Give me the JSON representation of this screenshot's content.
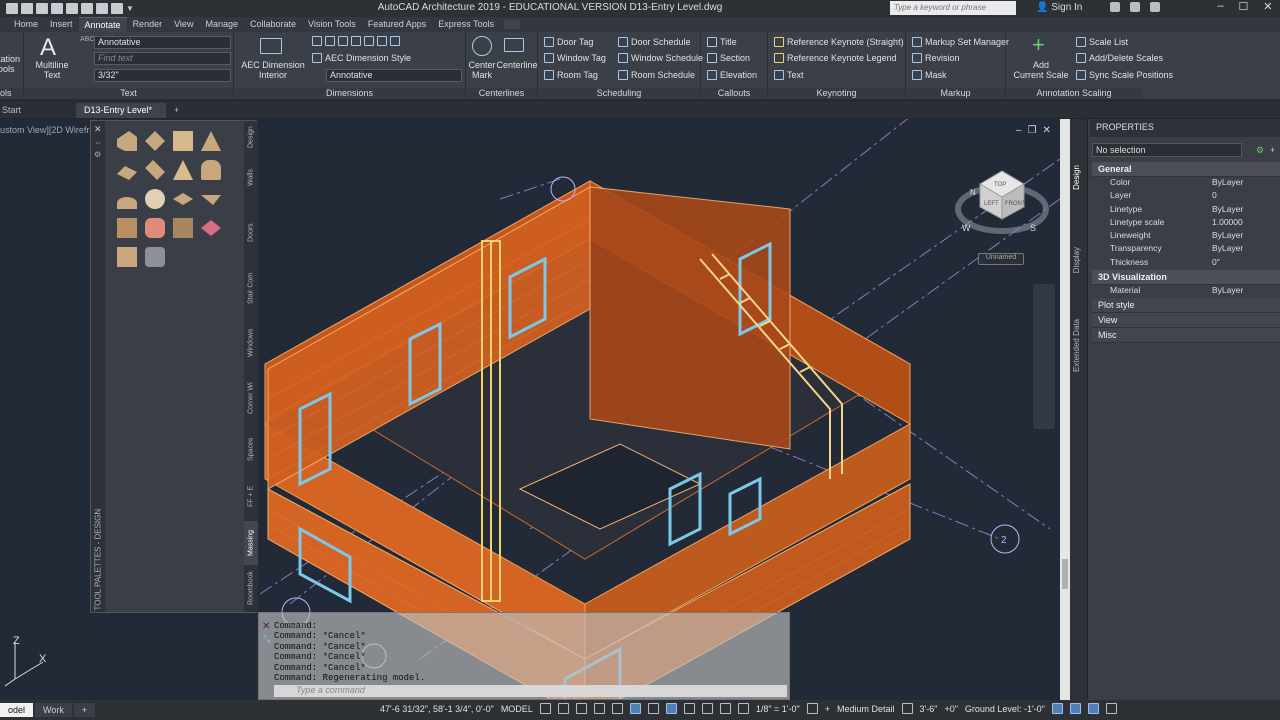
{
  "titlebar": {
    "title": "AutoCAD Architecture 2019 - EDUCATIONAL VERSION    D13-Entry Level.dwg",
    "search_placeholder": "Type a keyword or phrase",
    "signin": "Sign In"
  },
  "menu_tabs": [
    "Home",
    "Insert",
    "Annotate",
    "Render",
    "View",
    "Manage",
    "Collaborate",
    "Vision Tools",
    "Featured Apps",
    "Express Tools"
  ],
  "active_tab": "Annotate",
  "ribbon": {
    "text_panel": {
      "label": "Text",
      "partial_label": "tation\nools",
      "multiline": "Multiline\nText",
      "style": "Annotative",
      "find_placeholder": "Find text",
      "height": "3/32\""
    },
    "dimensions_panel": {
      "label": "Dimensions",
      "aec_dim": "AEC Dimension\nInterior",
      "aec_dim_style": "AEC Dimension Style",
      "dim_style": "Annotative"
    },
    "centerlines_panel": {
      "label": "Centerlines",
      "center_mark": "Center\nMark",
      "centerline": "Centerline"
    },
    "scheduling_panel": {
      "label": "Scheduling",
      "door_tag": "Door Tag",
      "window_tag": "Window Tag",
      "room_tag": "Room Tag",
      "door_schedule": "Door Schedule",
      "window_schedule": "Window Schedule",
      "room_schedule": "Room Schedule"
    },
    "callouts_panel": {
      "label": "Callouts",
      "title": "Title",
      "section": "Section",
      "elevation": "Elevation"
    },
    "keynoting_panel": {
      "label": "Keynoting",
      "ref_straight": "Reference Keynote (Straight)",
      "ref_legend": "Reference Keynote Legend",
      "text": "Text"
    },
    "markup_panel": {
      "label": "Markup",
      "set_manager": "Markup Set Manager",
      "revision": "Revision",
      "mask": "Mask"
    },
    "annotation_scaling_panel": {
      "label": "Annotation Scaling",
      "add_current": "Add\nCurrent Scale",
      "scale_list": "Scale List",
      "add_delete": "Add/Delete Scales",
      "sync": "Sync Scale Positions"
    },
    "partial_label": "ols"
  },
  "file_tabs": {
    "start": "Start",
    "active": "D13-Entry Level*",
    "add": "+"
  },
  "viewport": {
    "label": "ustom View][2D Wirefra",
    "viewcube": {
      "top": "TOP",
      "left": "LEFT",
      "front": "FRONT",
      "compass_w": "W",
      "compass_s": "S",
      "compass_n": "N"
    },
    "unnamed": "Unnamed",
    "grid_bubble": "2"
  },
  "tool_palette": {
    "title": "TOOL PALETTES - DESIGN",
    "tabs": [
      "Design",
      "Walls",
      "Doors",
      "Stair Com",
      "Windows",
      "Corner Wi",
      "Spaces",
      "FF + E",
      "Massing",
      "Roombook"
    ],
    "active_tab": "Massing"
  },
  "command": {
    "lines": [
      "Command:",
      "Command: *Cancel*",
      "Command: *Cancel*",
      "Command: *Cancel*",
      "Command: *Cancel*",
      "Command:  Regenerating model."
    ],
    "placeholder": "Type a command"
  },
  "properties": {
    "header": "PROPERTIES",
    "selection": "No selection",
    "side_tabs": [
      "Design",
      "Display",
      "Extended Data"
    ],
    "sections": {
      "general": "General",
      "visualization": "3D Visualization",
      "plot_style": "Plot style",
      "view": "View",
      "misc": "Misc"
    },
    "general_rows": [
      {
        "k": "Color",
        "v": "ByLayer"
      },
      {
        "k": "Layer",
        "v": "0"
      },
      {
        "k": "Linetype",
        "v": "ByLayer"
      },
      {
        "k": "Linetype scale",
        "v": "1.00000"
      },
      {
        "k": "Lineweight",
        "v": "ByLayer"
      },
      {
        "k": "Transparency",
        "v": "ByLayer"
      },
      {
        "k": "Thickness",
        "v": "0\""
      }
    ],
    "viz_rows": [
      {
        "k": "Material",
        "v": "ByLayer"
      }
    ]
  },
  "statusbar": {
    "tabs": [
      "odel",
      "Work"
    ],
    "coords": "47'-6 31/32\", 58'-1 3/4\", 0'-0\"",
    "model": "MODEL",
    "scale": "1/8\" = 1'-0\"",
    "detail": "Medium Detail",
    "elevation": "3'-6\"",
    "offset": "+0\"",
    "ground": "Ground Level: -1'-0\""
  },
  "ucs": {
    "z": "Z",
    "x": "X"
  }
}
